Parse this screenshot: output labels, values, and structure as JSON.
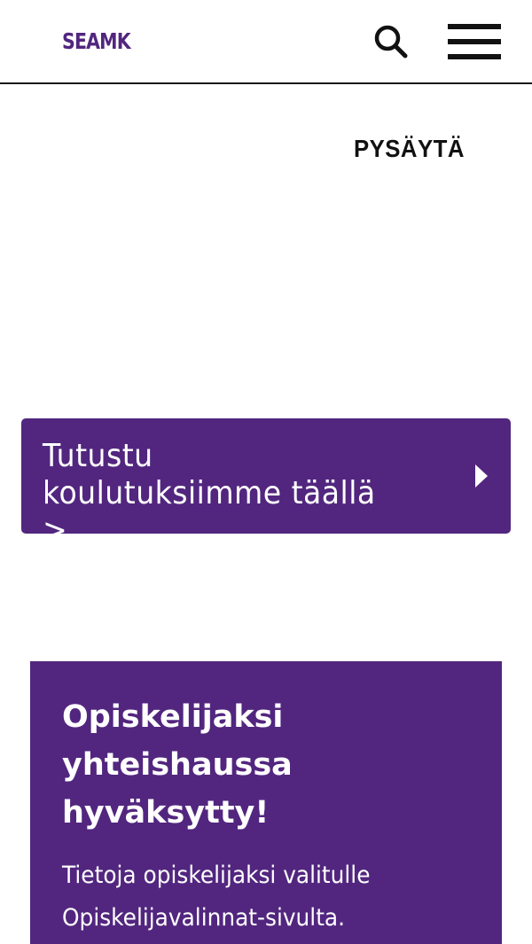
{
  "header": {
    "logo_text": "SEAMK",
    "search_icon": "search-icon",
    "menu_icon": "hamburger-menu-icon"
  },
  "hero": {
    "pause_label": "PYSÄYTÄ"
  },
  "cta": {
    "label": "Tutustu koulutuksiimme täällä >",
    "arrow_icon": "caret-right-icon"
  },
  "info_card": {
    "title": "Opiskelijaksi yhteishaussa hyväksytty!",
    "text": "Tietoja opiskelijaksi valitulle Opiskelijavalinnat-sivulta."
  },
  "colors": {
    "brand_purple": "#52267f",
    "text_dark": "#111111",
    "background": "#ffffff"
  }
}
